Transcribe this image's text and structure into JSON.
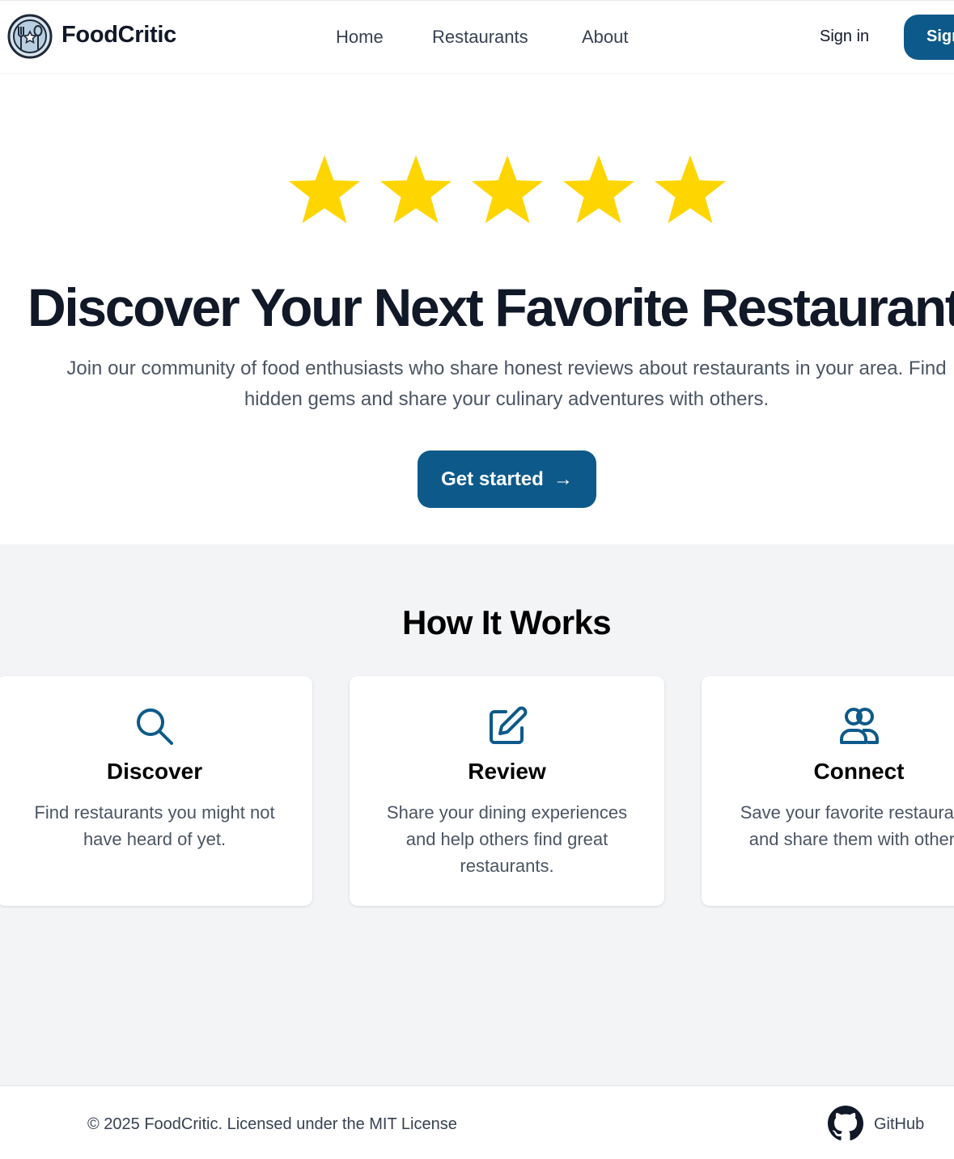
{
  "header": {
    "brand": "FoodCritic",
    "nav": [
      "Home",
      "Restaurants",
      "About"
    ],
    "sign_in": "Sign in",
    "sign_up": "Sign up"
  },
  "hero": {
    "rating": 5,
    "title": "Discover Your Next Favorite Restaurant",
    "subtitle": "Join our community of food enthusiasts who share honest reviews about restaurants in your area. Find hidden gems and share your culinary adventures with others.",
    "cta": "Get started",
    "cta_arrow": "→"
  },
  "how": {
    "title": "How It Works",
    "cards": [
      {
        "icon": "search-icon",
        "title": "Discover",
        "text": "Find restaurants you might not have heard of yet."
      },
      {
        "icon": "edit-icon",
        "title": "Review",
        "text": "Share your dining experiences and help others find great restaurants."
      },
      {
        "icon": "users-icon",
        "title": "Connect",
        "text": "Save your favorite restaurants and share them with others."
      }
    ]
  },
  "footer": {
    "copyright": "© 2025 FoodCritic. Licensed under the MIT License",
    "github": "GitHub"
  },
  "colors": {
    "primary": "#0d5a8a",
    "star": "#ffd500",
    "section_bg": "#f3f4f6"
  }
}
